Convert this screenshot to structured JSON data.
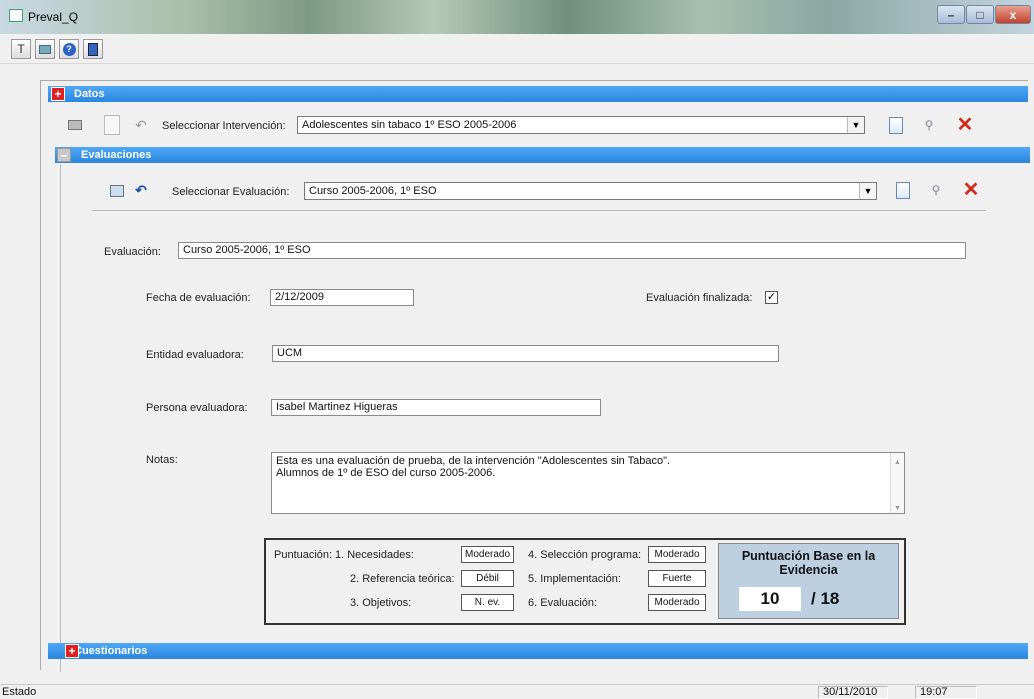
{
  "window": {
    "title": "Preval_Q",
    "minimize": "–",
    "maximize": "□",
    "close": "x"
  },
  "toolbar": {
    "icons": [
      "tools-icon",
      "image-icon",
      "help-icon",
      "exit-icon"
    ]
  },
  "datos": {
    "section_title": "Datos",
    "select_label": "Seleccionar Intervención:",
    "select_value": "Adolescentes sin tabaco 1º ESO 2005-2006"
  },
  "evaluaciones": {
    "section_title": "Evaluaciones",
    "select_label": "Seleccionar Evaluación:",
    "select_value": "Curso 2005-2006, 1º ESO"
  },
  "form": {
    "evaluacion_label": "Evaluación:",
    "evaluacion_value": "Curso 2005-2006, 1º ESO",
    "fecha_label": "Fecha de evaluación:",
    "fecha_value": "2/12/2009",
    "finalizada_label": "Evaluación finalizada:",
    "finalizada_checked": true,
    "entidad_label": "Entidad evaluadora:",
    "entidad_value": "UCM",
    "persona_label": "Persona evaluadora:",
    "persona_value": "Isabel Martinez Higueras",
    "notas_label": "Notas:",
    "notas_line1": "Esta es una evaluación de prueba, de la intervención \"Adolescentes sin Tabaco\".",
    "notas_line2": "Alumnos de 1º de ESO del curso 2005-2006."
  },
  "puntuacion": {
    "label": "Puntuación:",
    "items": [
      {
        "label": "1. Necesidades:",
        "value": "Moderado"
      },
      {
        "label": "2. Referencia teórica:",
        "value": "Débil"
      },
      {
        "label": "3. Objetivos:",
        "value": "N. ev."
      },
      {
        "label": "4. Selección programa:",
        "value": "Moderado"
      },
      {
        "label": "5. Implementación:",
        "value": "Fuerte"
      },
      {
        "label": "6. Evaluación:",
        "value": "Moderado"
      }
    ],
    "base_title": "Puntuación Base en la Evidencia",
    "base_score": "10",
    "base_total": "/ 18"
  },
  "cuestionarios": {
    "section_title": "Cuestionarios"
  },
  "status": {
    "estado": "Estado",
    "date": "30/11/2010",
    "time": "19:07"
  },
  "colors": {
    "section_blue": "#2b86e0",
    "accent_red": "#e02020",
    "score_panel": "#bdd0e2"
  }
}
